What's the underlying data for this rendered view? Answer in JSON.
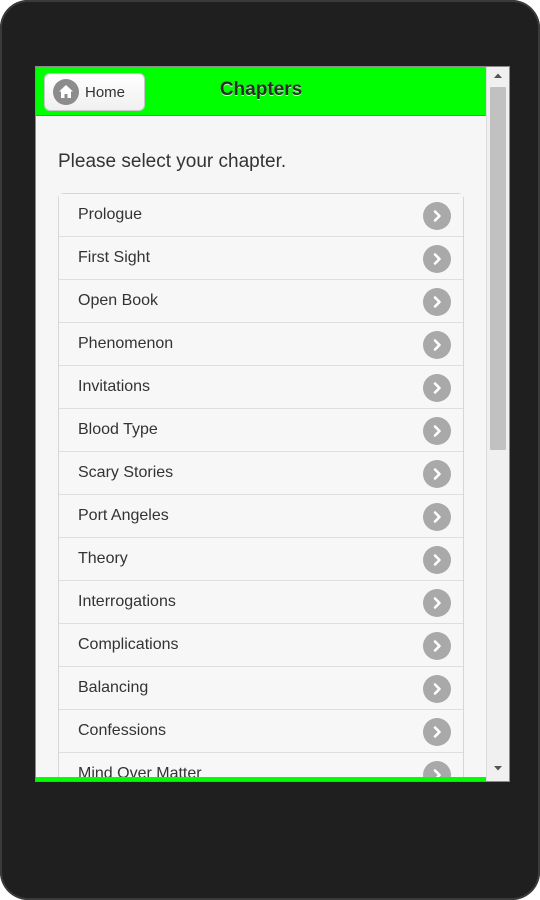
{
  "header": {
    "home_label": "Home",
    "title": "Chapters",
    "bar_color": "#00ff00"
  },
  "prompt": "Please select your chapter.",
  "chapters": [
    {
      "label": "Prologue"
    },
    {
      "label": "First Sight"
    },
    {
      "label": "Open Book"
    },
    {
      "label": "Phenomenon"
    },
    {
      "label": "Invitations"
    },
    {
      "label": "Blood Type"
    },
    {
      "label": "Scary Stories"
    },
    {
      "label": "Port Angeles"
    },
    {
      "label": "Theory"
    },
    {
      "label": "Interrogations"
    },
    {
      "label": "Complications"
    },
    {
      "label": "Balancing"
    },
    {
      "label": "Confessions"
    },
    {
      "label": "Mind Over Matter"
    }
  ],
  "icons": {
    "home": "home-icon",
    "item_arrow": "chevron-right-icon"
  }
}
